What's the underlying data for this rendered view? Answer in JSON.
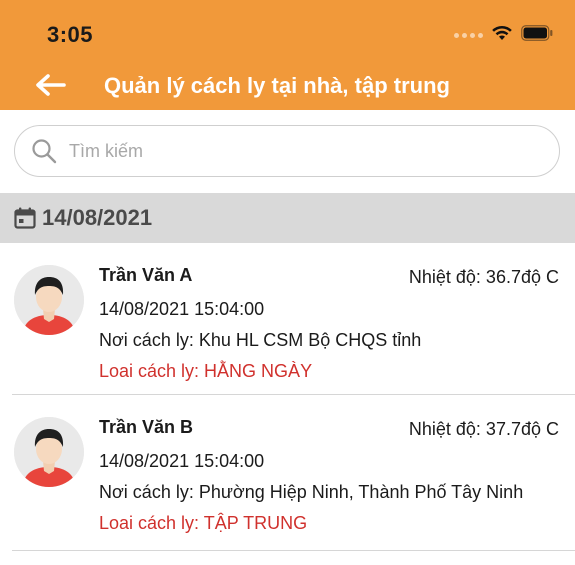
{
  "status_bar": {
    "time": "3:05"
  },
  "app_bar": {
    "title": "Quản lý cách ly tại nhà, tập trung",
    "back_icon": "arrow-left-icon"
  },
  "search": {
    "placeholder": "Tìm kiếm",
    "value": ""
  },
  "section": {
    "date": "14/08/2021",
    "icon": "calendar-icon"
  },
  "records": [
    {
      "name": "Trần Văn A",
      "temperature": "Nhiệt độ: 36.7độ C",
      "datetime": "14/08/2021 15:04:00",
      "location": "Nơi cách ly: Khu HL CSM Bộ CHQS tỉnh",
      "type": "Loai cách ly: HẰNG NGÀY"
    },
    {
      "name": "Trần Văn B",
      "temperature": "Nhiệt độ: 37.7độ C",
      "datetime": "14/08/2021 15:04:00",
      "location": "Nơi cách ly: Phường Hiệp Ninh, Thành Phố Tây Ninh",
      "type": "Loai cách ly: TẬP TRUNG"
    }
  ],
  "colors": {
    "header": "#F1993A",
    "section_bg": "#D9D9D9",
    "type_text": "#D0312D",
    "avatar_shirt": "#E8453C"
  }
}
